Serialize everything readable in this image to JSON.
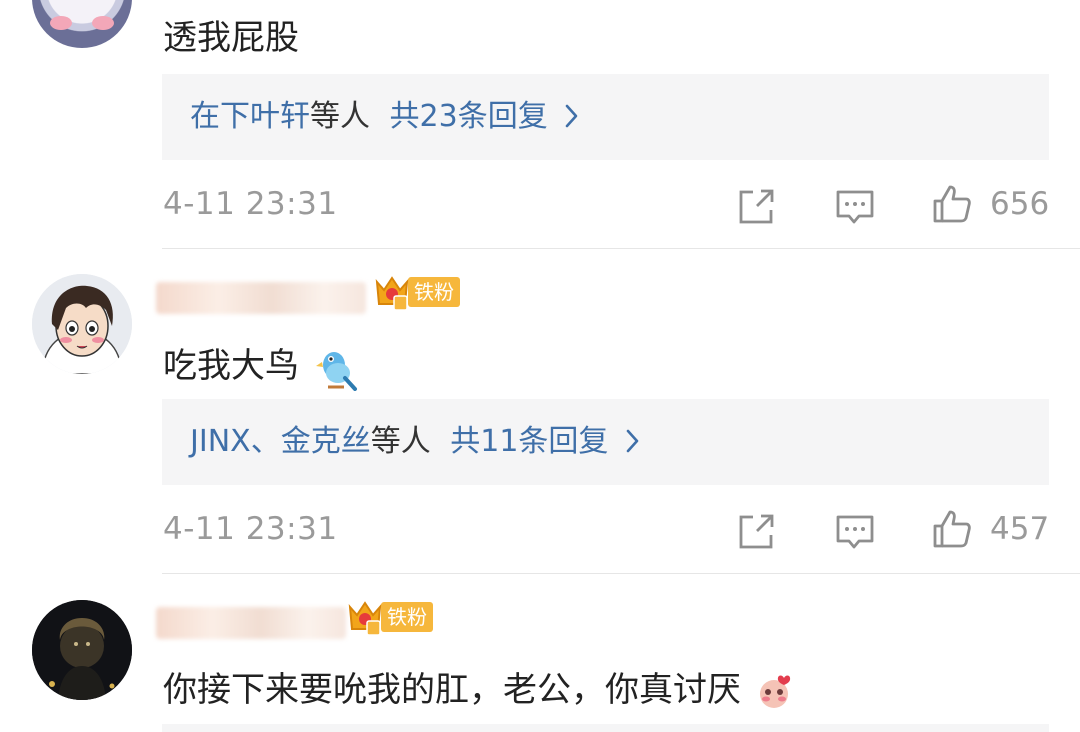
{
  "comments": [
    {
      "text": "透我屁股",
      "replies_names": "在下叶轩",
      "replies_suffix": "等人",
      "replies_count": "共23条回复",
      "timestamp": "4-11 23:31",
      "likes": "656"
    },
    {
      "badge": "铁粉",
      "badge_level": "1",
      "text": "吃我大鸟",
      "replies_names": "JINX、金克丝",
      "replies_suffix": "等人",
      "replies_count": "共11条回复",
      "timestamp": "4-11 23:31",
      "likes": "457"
    },
    {
      "badge": "铁粉",
      "badge_level": "4",
      "text": "你接下来要吮我的肛，老公，你真讨厌"
    }
  ],
  "icons": {
    "share": "share-icon",
    "reply": "comment-icon",
    "like": "thumbs-up-icon",
    "chevron": "chevron-right-icon"
  },
  "colors": {
    "link": "#3f6fa8",
    "muted": "#9a9a9a",
    "badge": "#f6b73c",
    "reply_bg": "#f5f5f6"
  }
}
